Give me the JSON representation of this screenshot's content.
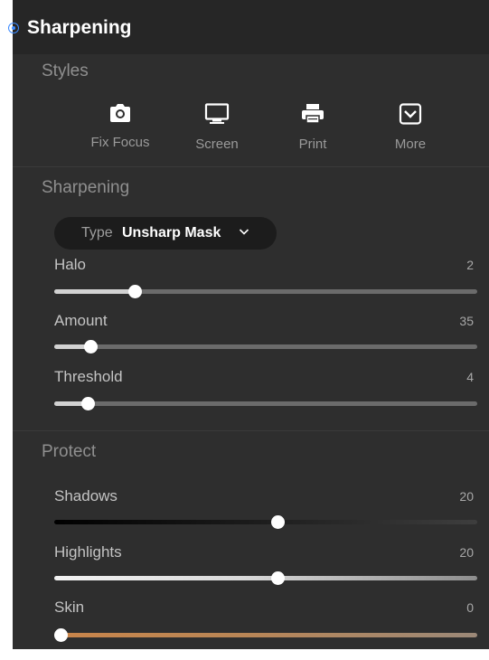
{
  "panel": {
    "title": "Sharpening",
    "active_color": "#3d8bff"
  },
  "styles": {
    "section_title": "Styles",
    "buttons": [
      {
        "label": "Fix Focus",
        "icon": "camera-icon"
      },
      {
        "label": "Screen",
        "icon": "monitor-icon"
      },
      {
        "label": "Print",
        "icon": "printer-icon"
      },
      {
        "label": "More",
        "icon": "dropdown-box-icon"
      }
    ]
  },
  "sharpening": {
    "section_title": "Sharpening",
    "type_label": "Type",
    "type_value": "Unsharp Mask",
    "sliders": [
      {
        "label": "Halo",
        "value": "2",
        "fraction": 0.19
      },
      {
        "label": "Amount",
        "value": "35",
        "fraction": 0.085
      },
      {
        "label": "Threshold",
        "value": "4",
        "fraction": 0.078
      }
    ]
  },
  "protect": {
    "section_title": "Protect",
    "sliders": [
      {
        "label": "Shadows",
        "value": "20",
        "fraction": 0.527
      },
      {
        "label": "Highlights",
        "value": "20",
        "fraction": 0.527
      },
      {
        "label": "Skin",
        "value": "0",
        "fraction": 0.015
      }
    ]
  }
}
